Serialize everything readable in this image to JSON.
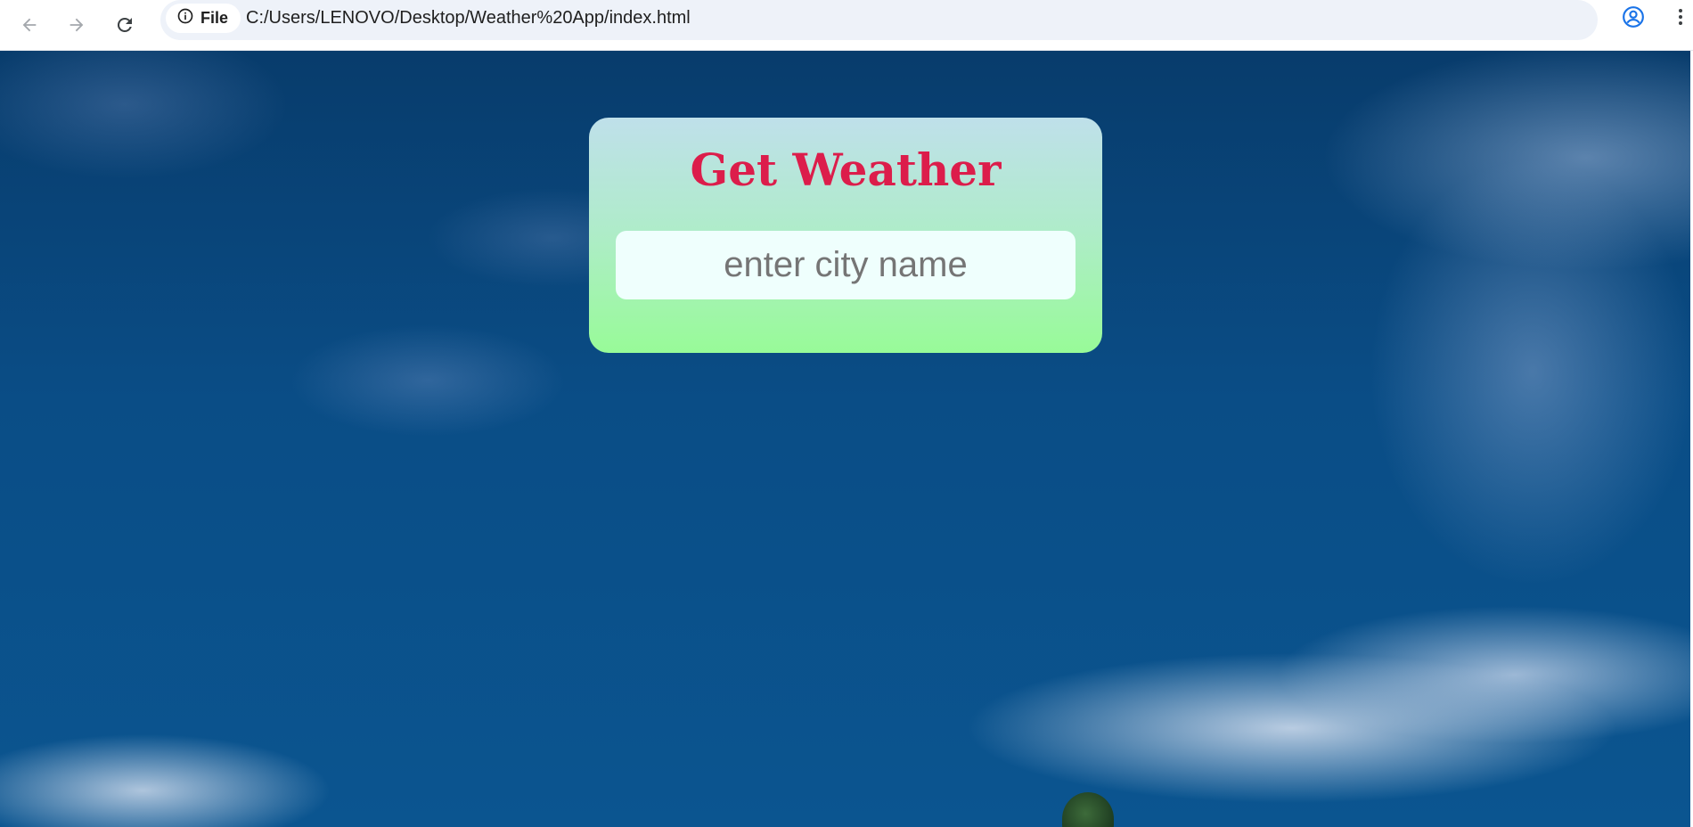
{
  "browser": {
    "site_info_label": "File",
    "url": "C:/Users/LENOVO/Desktop/Weather%20App/index.html",
    "icons": {
      "back": "back-arrow-icon",
      "forward": "forward-arrow-icon",
      "reload": "reload-icon",
      "site_info": "info-circle-icon",
      "bookmark": "star-icon",
      "profile": "profile-icon",
      "menu": "more-vert-icon"
    }
  },
  "app": {
    "title": "Get Weather",
    "search": {
      "placeholder": "enter city name",
      "value": ""
    }
  },
  "colors": {
    "title": "#dc1d4b",
    "card_top": "#bfe0ea",
    "card_bottom": "#98fb98",
    "input_bg": "#effffd",
    "sky": "#0a4d86",
    "profile_accent": "#1a73e8"
  }
}
